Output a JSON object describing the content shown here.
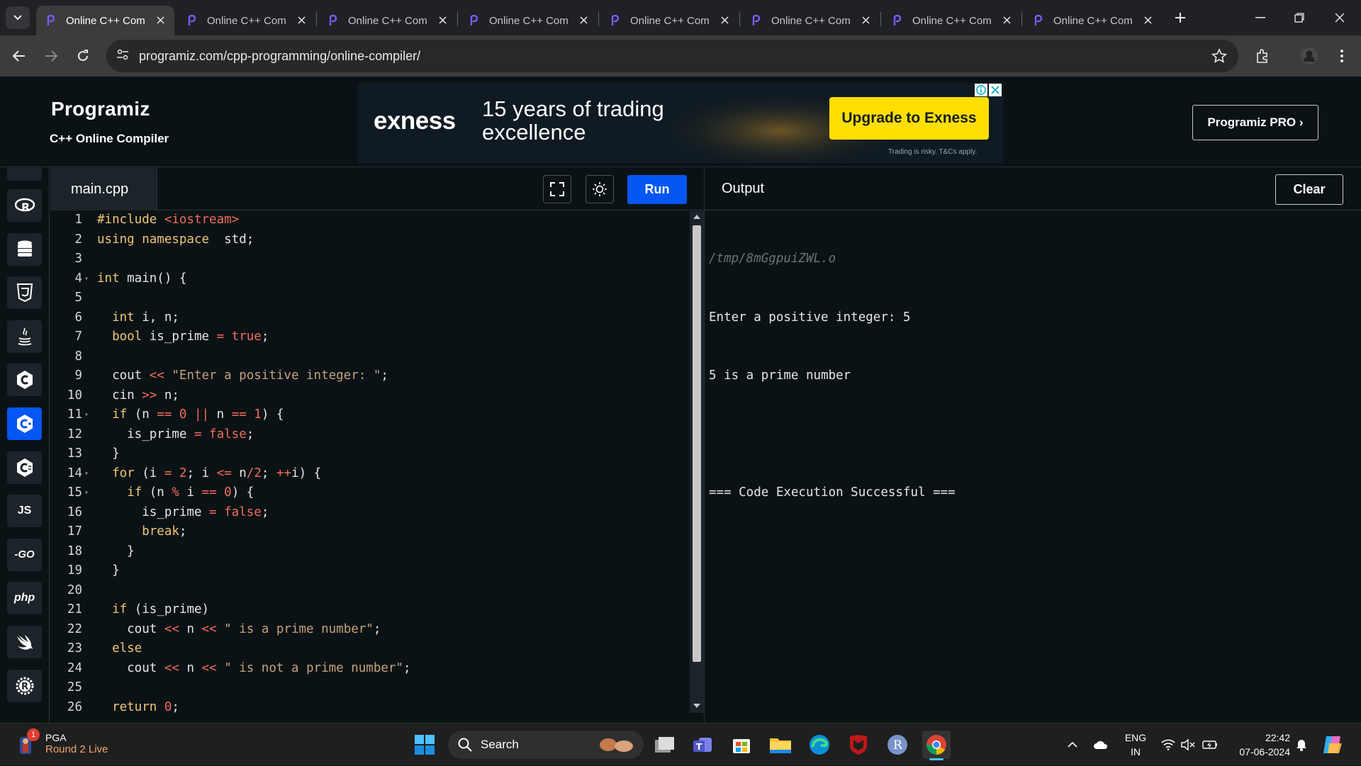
{
  "browser": {
    "tabs": [
      {
        "title": "Online C++ Com",
        "active": true
      },
      {
        "title": "Online C++ Com",
        "active": false
      },
      {
        "title": "Online C++ Com",
        "active": false
      },
      {
        "title": "Online C++ Com",
        "active": false
      },
      {
        "title": "Online C++ Com",
        "active": false
      },
      {
        "title": "Online C++ Com",
        "active": false
      },
      {
        "title": "Online C++ Com",
        "active": false
      },
      {
        "title": "Online C++ Com",
        "active": false
      }
    ],
    "url": "programiz.com/cpp-programming/online-compiler/"
  },
  "header": {
    "logo": "Programiz",
    "subtitle": "C++ Online Compiler",
    "pro_button": "Programiz PRO ›"
  },
  "ad": {
    "brand": "exness",
    "headline": "15 years of trading excellence",
    "cta": "Upgrade to Exness",
    "disclaimer": "Trading is risky. T&Cs apply.",
    "brand_color": "#ffde02"
  },
  "languages": [
    {
      "name": "R",
      "icon": "r-icon",
      "active": false
    },
    {
      "name": "SQL",
      "icon": "database-icon",
      "active": false
    },
    {
      "name": "HTML",
      "icon": "html5-icon",
      "active": false
    },
    {
      "name": "Java",
      "icon": "java-icon",
      "active": false
    },
    {
      "name": "C",
      "icon": "c-icon",
      "active": false
    },
    {
      "name": "C++",
      "icon": "cpp-icon",
      "active": true
    },
    {
      "name": "C#",
      "icon": "csharp-icon",
      "active": false
    },
    {
      "name": "JS",
      "icon": "js-icon",
      "active": false
    },
    {
      "name": "GO",
      "icon": "go-icon",
      "active": false
    },
    {
      "name": "php",
      "icon": "php-icon",
      "active": false
    },
    {
      "name": "Swift",
      "icon": "swift-icon",
      "active": false
    },
    {
      "name": "Rust",
      "icon": "rust-icon",
      "active": false
    }
  ],
  "editor": {
    "filename": "main.cpp",
    "run_label": "Run",
    "accent": "#0556f3",
    "lines": [
      {
        "n": "1",
        "fold": false,
        "tokens": [
          [
            "kw",
            "#include "
          ],
          [
            "inc",
            "<iostream>"
          ]
        ]
      },
      {
        "n": "2",
        "fold": false,
        "tokens": [
          [
            "kw",
            "using namespace"
          ],
          [
            "",
            "  std;"
          ]
        ]
      },
      {
        "n": "3",
        "fold": false,
        "tokens": []
      },
      {
        "n": "4",
        "fold": true,
        "tokens": [
          [
            "kw",
            "int"
          ],
          [
            "",
            " main() {"
          ]
        ]
      },
      {
        "n": "5",
        "fold": false,
        "tokens": []
      },
      {
        "n": "6",
        "fold": false,
        "tokens": [
          [
            "",
            "  "
          ],
          [
            "kw",
            "int"
          ],
          [
            "",
            " i, n;"
          ]
        ]
      },
      {
        "n": "7",
        "fold": false,
        "tokens": [
          [
            "",
            "  "
          ],
          [
            "kw",
            "bool"
          ],
          [
            "",
            " is_prime "
          ],
          [
            "op",
            "="
          ],
          [
            " bool",
            " true"
          ],
          [
            "",
            ";"
          ]
        ]
      },
      {
        "n": "8",
        "fold": false,
        "tokens": []
      },
      {
        "n": "9",
        "fold": false,
        "tokens": [
          [
            "",
            "  cout "
          ],
          [
            "op",
            "<<"
          ],
          [
            "str",
            " \"Enter a positive integer: \""
          ],
          [
            "",
            ";"
          ]
        ]
      },
      {
        "n": "10",
        "fold": false,
        "tokens": [
          [
            "",
            "  cin "
          ],
          [
            "op",
            ">>"
          ],
          [
            "",
            " n;"
          ]
        ]
      },
      {
        "n": "11",
        "fold": true,
        "tokens": [
          [
            "",
            "  "
          ],
          [
            "kw",
            "if"
          ],
          [
            "",
            " (n "
          ],
          [
            "op",
            "=="
          ],
          [
            "num",
            " 0"
          ],
          [
            "op",
            " ||"
          ],
          [
            "",
            " n "
          ],
          [
            "op",
            "=="
          ],
          [
            "num",
            " 1"
          ],
          [
            "",
            ") {"
          ]
        ]
      },
      {
        "n": "12",
        "fold": false,
        "tokens": [
          [
            "",
            "    is_prime "
          ],
          [
            "op",
            "="
          ],
          [
            "bool",
            " false"
          ],
          [
            "",
            ";"
          ]
        ]
      },
      {
        "n": "13",
        "fold": false,
        "tokens": [
          [
            "",
            "  }"
          ]
        ]
      },
      {
        "n": "14",
        "fold": true,
        "tokens": [
          [
            "",
            "  "
          ],
          [
            "kw",
            "for"
          ],
          [
            "",
            " (i "
          ],
          [
            "op",
            "="
          ],
          [
            "num",
            " 2"
          ],
          [
            "",
            "; i "
          ],
          [
            "op",
            "<="
          ],
          [
            "",
            " n"
          ],
          [
            "op",
            "/"
          ],
          [
            "num",
            "2"
          ],
          [
            "",
            "; "
          ],
          [
            "op",
            "++"
          ],
          [
            "",
            "i) {"
          ]
        ]
      },
      {
        "n": "15",
        "fold": true,
        "tokens": [
          [
            "",
            "    "
          ],
          [
            "kw",
            "if"
          ],
          [
            "",
            " (n "
          ],
          [
            "op",
            "%"
          ],
          [
            "",
            " i "
          ],
          [
            "op",
            "=="
          ],
          [
            "num",
            " 0"
          ],
          [
            "",
            ") {"
          ]
        ]
      },
      {
        "n": "16",
        "fold": false,
        "tokens": [
          [
            "",
            "      is_prime "
          ],
          [
            "op",
            "="
          ],
          [
            "bool",
            " false"
          ],
          [
            "",
            ";"
          ]
        ]
      },
      {
        "n": "17",
        "fold": false,
        "tokens": [
          [
            "",
            "      "
          ],
          [
            "kw",
            "break"
          ],
          [
            "",
            ";"
          ]
        ]
      },
      {
        "n": "18",
        "fold": false,
        "tokens": [
          [
            "",
            "    }"
          ]
        ]
      },
      {
        "n": "19",
        "fold": false,
        "tokens": [
          [
            "",
            "  }"
          ]
        ]
      },
      {
        "n": "20",
        "fold": false,
        "tokens": []
      },
      {
        "n": "21",
        "fold": false,
        "tokens": [
          [
            "",
            "  "
          ],
          [
            "kw",
            "if"
          ],
          [
            "",
            " (is_prime)"
          ]
        ]
      },
      {
        "n": "22",
        "fold": false,
        "tokens": [
          [
            "",
            "    cout "
          ],
          [
            "op",
            "<<"
          ],
          [
            "",
            " n "
          ],
          [
            "op",
            "<<"
          ],
          [
            "str",
            " \" is a prime number\""
          ],
          [
            "",
            ";"
          ]
        ]
      },
      {
        "n": "23",
        "fold": false,
        "tokens": [
          [
            "",
            "  "
          ],
          [
            "kw",
            "else"
          ]
        ]
      },
      {
        "n": "24",
        "fold": false,
        "tokens": [
          [
            "",
            "    cout "
          ],
          [
            "op",
            "<<"
          ],
          [
            "",
            " n "
          ],
          [
            "op",
            "<<"
          ],
          [
            "str",
            " \" is not a prime number\""
          ],
          [
            "",
            ";"
          ]
        ]
      },
      {
        "n": "25",
        "fold": false,
        "tokens": []
      },
      {
        "n": "26",
        "fold": false,
        "tokens": [
          [
            "",
            "  "
          ],
          [
            "kw",
            "return"
          ],
          [
            "num",
            " 0"
          ],
          [
            "",
            ";"
          ]
        ]
      }
    ]
  },
  "output": {
    "title": "Output",
    "clear_label": "Clear",
    "path": "/tmp/8mGgpuiZWL.o",
    "lines": [
      "Enter a positive integer: 5",
      "5 is a prime number",
      "",
      "=== Code Execution Successful ==="
    ]
  },
  "taskbar": {
    "widget_badge": "1",
    "widget_title": "PGA",
    "widget_sub": "Round 2 Live",
    "search_placeholder": "Search",
    "lang_line1": "ENG",
    "lang_line2": "IN",
    "time": "22:42",
    "date": "07-06-2024"
  }
}
